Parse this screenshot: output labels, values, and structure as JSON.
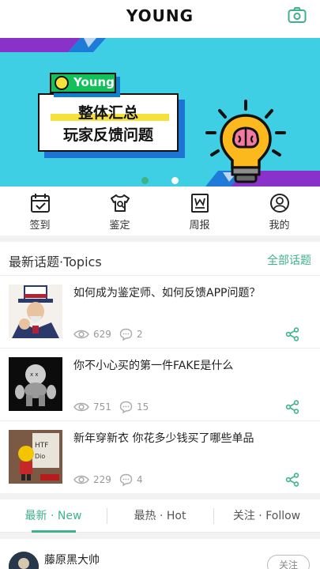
{
  "header": {
    "title": "YOUNG",
    "accent": "#3fb28a"
  },
  "banner": {
    "badge_text": "Young",
    "line1": "整体汇总",
    "line2": "玩家反馈问题",
    "active_dot": 1,
    "dot_count": 2
  },
  "nav": [
    {
      "label": "签到",
      "icon": "calendar-check-icon"
    },
    {
      "label": "鉴定",
      "icon": "tshirt-icon"
    },
    {
      "label": "周报",
      "icon": "weekly-report-icon"
    },
    {
      "label": "我的",
      "icon": "profile-icon"
    }
  ],
  "topics": {
    "title": "最新话题·Topics",
    "all_link": "全部话题",
    "items": [
      {
        "title": "如何成为鉴定师、如何反馈APP问题？",
        "views": "629",
        "comments": "2"
      },
      {
        "title": "你不小心买的第一件FAKE是什么",
        "views": "751",
        "comments": "15"
      },
      {
        "title": "新年穿新衣 你花多少钱买了哪些单品",
        "views": "229",
        "comments": "4"
      }
    ]
  },
  "tabs": [
    {
      "label": "最新 · New",
      "active": true
    },
    {
      "label": "最热 · Hot",
      "active": false
    },
    {
      "label": "关注 · Follow",
      "active": false
    }
  ],
  "feed": {
    "user_name": "藤原黑大帅",
    "follow_label": "关注"
  }
}
